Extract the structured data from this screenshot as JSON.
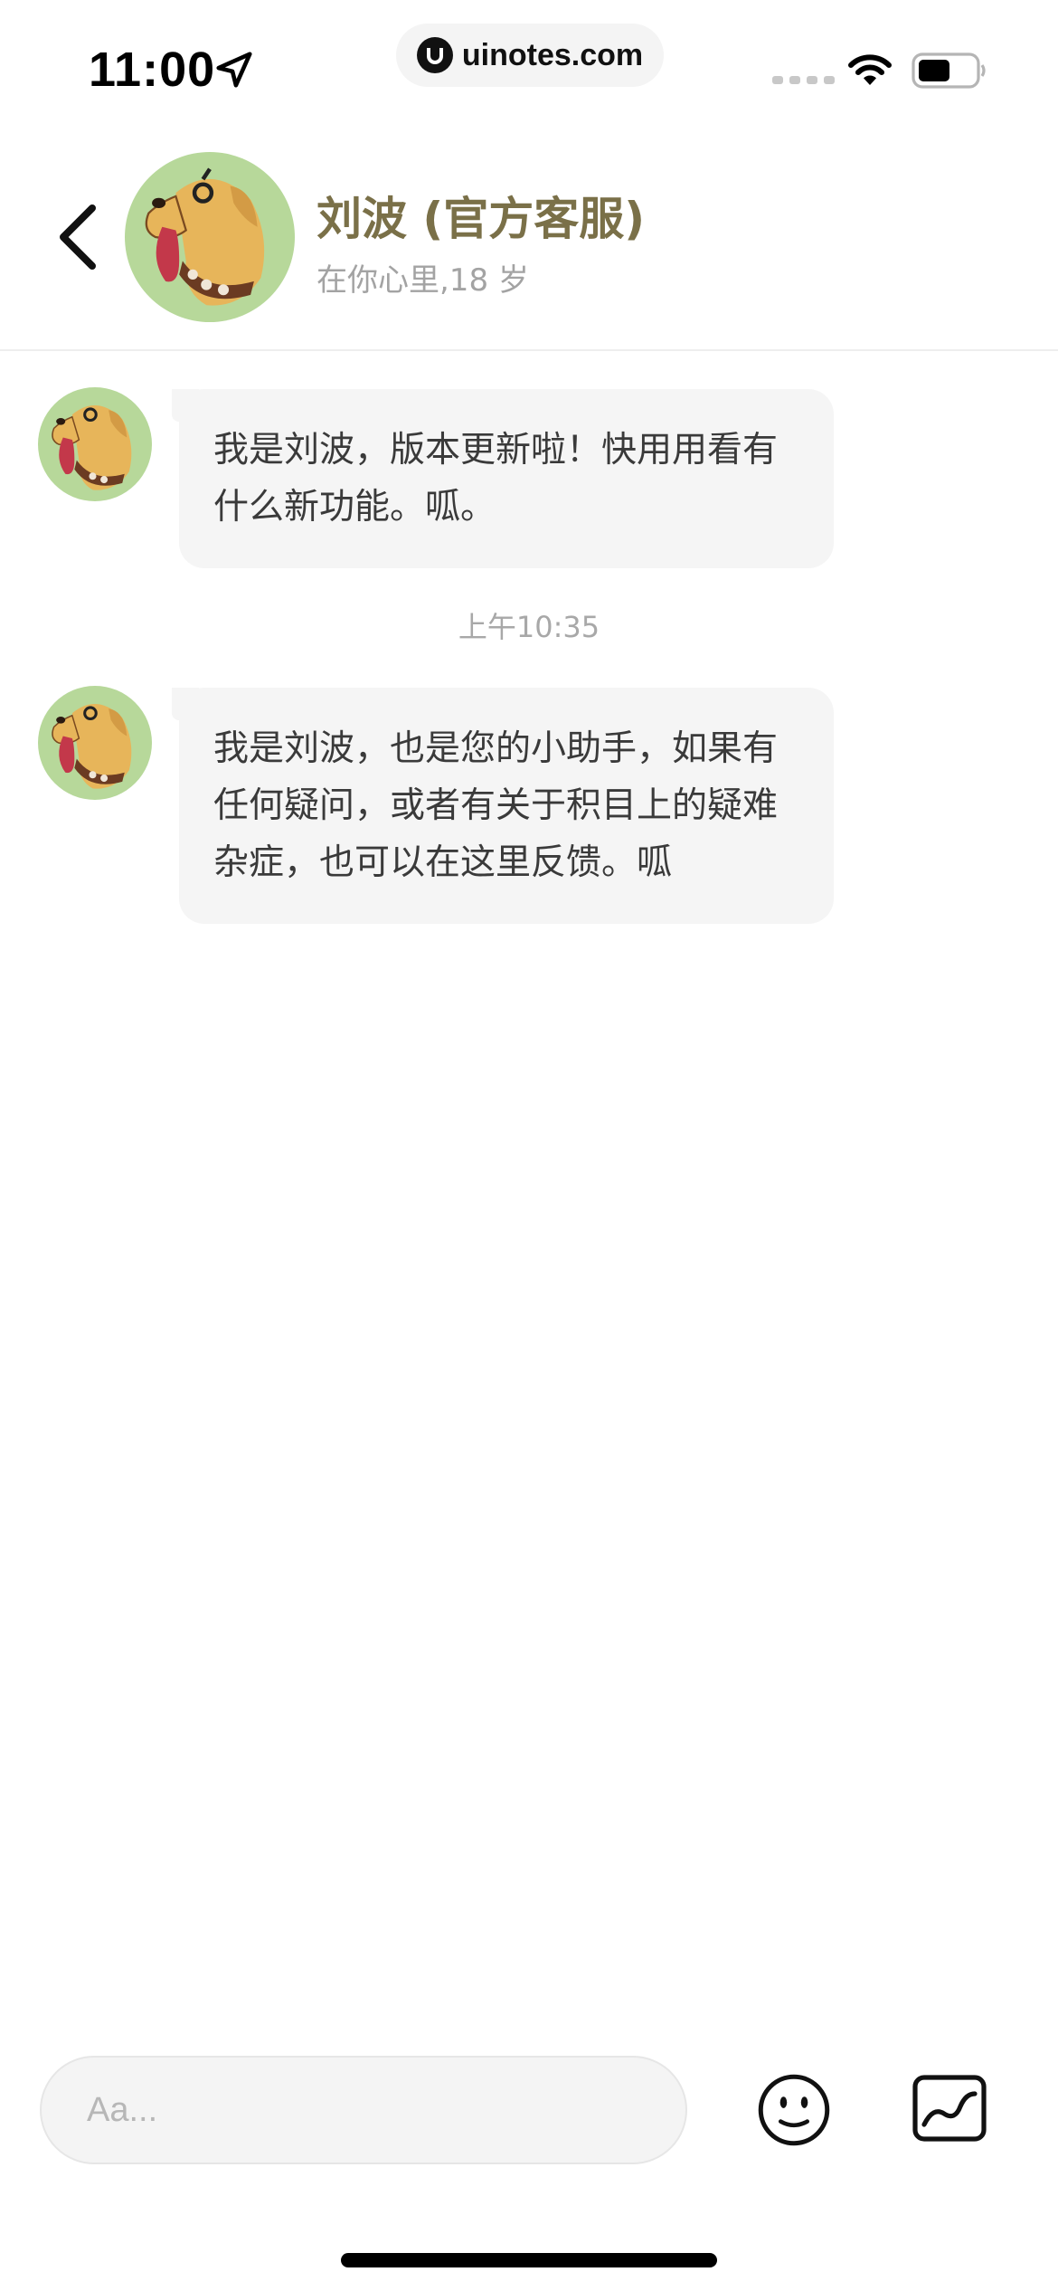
{
  "status_bar": {
    "time": "11:00",
    "url": "uinotes.com"
  },
  "header": {
    "contact_name": "刘波 (官方客服)",
    "contact_subtitle": "在你心里,18 岁"
  },
  "messages": [
    {
      "text": "我是刘波，版本更新啦！快用用看有什么新功能。呱。"
    },
    {
      "text": "我是刘波，也是您的小助手，如果有任何疑问，或者有关于积目上的疑难杂症，也可以在这里反馈。呱"
    }
  ],
  "timestamp": "上午10:35",
  "composer": {
    "placeholder": "Aa..."
  },
  "colors": {
    "name": "#7a7048",
    "avatar_bg": "#b7d89a",
    "dog": "#e7b55a",
    "bubble": "#f5f5f5"
  },
  "icons": [
    "location-arrow-icon",
    "wifi-icon",
    "battery-icon",
    "back-chevron-icon",
    "emoji-icon",
    "image-icon"
  ]
}
